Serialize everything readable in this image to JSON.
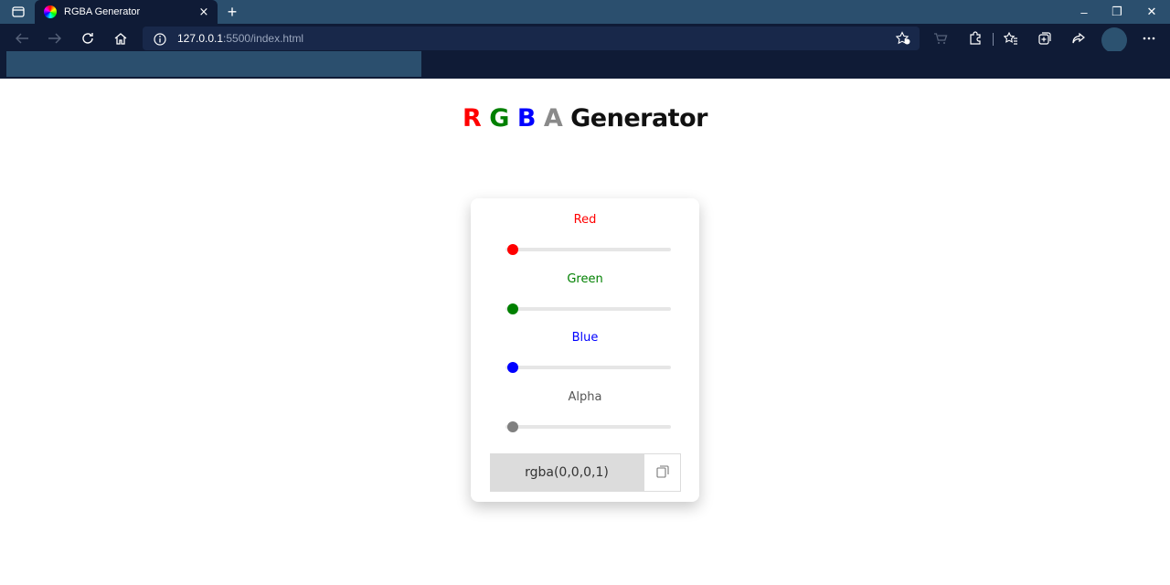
{
  "browser": {
    "tab_title": "RGBA Generator",
    "tab_close": "×",
    "new_tab": "+",
    "url_host": "127.0.0.1",
    "url_rest": ":5500/index.html",
    "window_controls": {
      "minimize": "–",
      "restore": "❐",
      "close": "✕"
    }
  },
  "page": {
    "heading": {
      "r": "R",
      "g": "G",
      "b": "B",
      "a": "A",
      "rest": "Generator"
    },
    "sliders": [
      {
        "label": "Red",
        "color": "#ff0000",
        "value": 0,
        "max": 255
      },
      {
        "label": "Green",
        "color": "#008000",
        "value": 0,
        "max": 255
      },
      {
        "label": "Blue",
        "color": "#0000ff",
        "value": 0,
        "max": 255
      },
      {
        "label": "Alpha",
        "color": "#808080",
        "value": 1,
        "max": 1
      }
    ],
    "output_value": "rgba(0,0,0,1)",
    "copy_icon": "copy-icon"
  },
  "colors": {
    "tabbar": "#2b4f6e",
    "toolbar": "#0f1b36",
    "red": "#ff0000",
    "green": "#008000",
    "blue": "#0000ff",
    "alpha": "#808080"
  }
}
